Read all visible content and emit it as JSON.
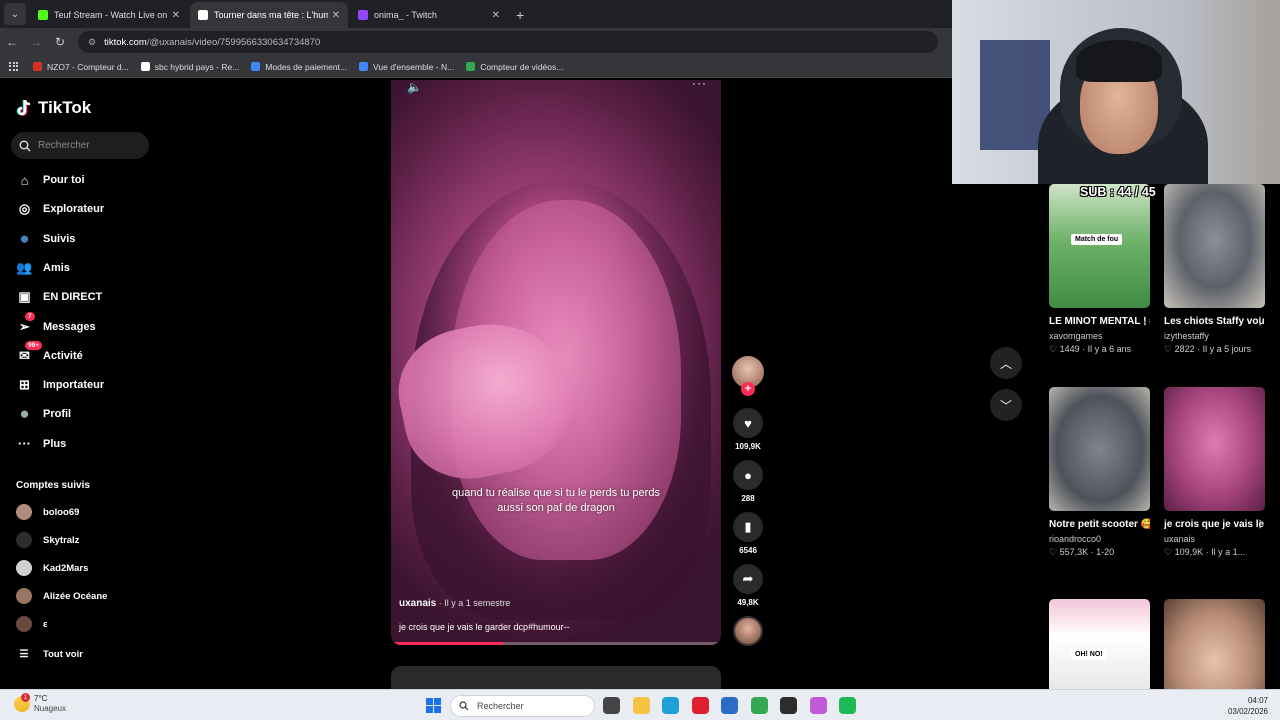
{
  "browser": {
    "tabs": [
      {
        "title": "Teuf Stream - Watch Live on Kick",
        "icon_color": "#53fc18",
        "active": false
      },
      {
        "title": "Tourner dans ma tête : L'humour",
        "icon_color": "#ffffff",
        "active": true
      },
      {
        "title": "onima_ - Twitch",
        "icon_color": "#9146ff",
        "active": false
      }
    ],
    "url_host": "tiktok.com",
    "url_path": "/@uxanais/video/7599566330634734870",
    "bookmarks": [
      {
        "label": "NZO7 - Compteur d...",
        "icon_color": "#d93025"
      },
      {
        "label": "sbc hybrid pays - Re...",
        "icon_color": "#ffffff"
      },
      {
        "label": "Modes de paiement...",
        "icon_color": "#4285f4"
      },
      {
        "label": "Vue d'ensemble - N...",
        "icon_color": "#4285f4"
      },
      {
        "label": "Compteur de vidéos...",
        "icon_color": "#34a853"
      }
    ]
  },
  "tiktok": {
    "logo": "TikTok",
    "search_placeholder": "Rechercher",
    "nav": [
      {
        "label": "Pour toi",
        "icon": "home-icon",
        "glyph": "⌂"
      },
      {
        "label": "Explorateur",
        "icon": "compass-icon",
        "glyph": "◎"
      },
      {
        "label": "Suivis",
        "icon": "following-avatar-icon",
        "glyph": "●"
      },
      {
        "label": "Amis",
        "icon": "friends-icon",
        "glyph": "👥"
      },
      {
        "label": "EN DIRECT",
        "icon": "live-icon",
        "glyph": "▣"
      },
      {
        "label": "Messages",
        "icon": "messages-icon",
        "glyph": "➢",
        "badge": "7"
      },
      {
        "label": "Activité",
        "icon": "activity-icon",
        "glyph": "✉",
        "badge": "99+"
      },
      {
        "label": "Importateur",
        "icon": "upload-icon",
        "glyph": "⊞"
      },
      {
        "label": "Profil",
        "icon": "profile-avatar-icon",
        "glyph": "●"
      },
      {
        "label": "Plus",
        "icon": "more-icon",
        "glyph": "···"
      }
    ],
    "following_title": "Comptes suivis",
    "following": [
      {
        "name": "boloo69",
        "color": "#b08b7a"
      },
      {
        "name": "Skytralz",
        "color": "#2d2d2d"
      },
      {
        "name": "Kad2Mars",
        "color": "#d0d0d0"
      },
      {
        "name": "Alizée Océane",
        "color": "#9a7565"
      },
      {
        "name": "ε",
        "color": "#6b4a44"
      }
    ],
    "see_all": "Tout voir"
  },
  "video": {
    "caption": "quand tu réalise que si tu le perds tu perds aussi son paf de dragon",
    "author": "uxanais",
    "time": " · Il y a 1 semestre",
    "description": "je crois que je vais le garder dcp#humour--",
    "progress": 0.34,
    "likes": "109,9K",
    "comments": "288",
    "saves": "6546",
    "shares": "49,8K"
  },
  "stream_overlay": {
    "sub_counter": "SUB : 44 / 45"
  },
  "suggestions": [
    {
      "title": "LE MINOT MENTAL ! #olympisme...",
      "author": "xavomgames",
      "stats": "♡ 1449 · Il y a 6 ans",
      "thumb": "soccer",
      "thumb_text": "Match de fou"
    },
    {
      "title": "Les chiots Staffy vous bercent...",
      "author": "izythestaffy",
      "stats": "♡ 2822 · Il y a 5 jours",
      "thumb": "puppy",
      "thumb_text": ""
    },
    {
      "title": "Notre petit scooter 🥰🙈🥹",
      "author": "rioandrocco0",
      "stats": "♡ 557,3K · 1-20",
      "thumb": "dog",
      "thumb_text": ""
    },
    {
      "title": "je crois que je vais le garder dcp...",
      "author": "uxanais",
      "stats": "♡ 109,9K · Il y a 1...",
      "thumb": "pink",
      "thumb_text": ""
    },
    {
      "title": "",
      "author": "",
      "stats": "",
      "thumb": "ohno",
      "thumb_text": "OH! NO!"
    },
    {
      "title": "",
      "author": "",
      "stats": "",
      "thumb": "girl",
      "thumb_text": ""
    }
  ],
  "taskbar": {
    "temperature": "7°C",
    "weather": "Nuageux",
    "weather_badge": "1",
    "search_placeholder": "Rechercher",
    "time": "04:07",
    "date": "03/02/2026",
    "apps": [
      {
        "name": "task-view-icon",
        "color": "#444444"
      },
      {
        "name": "file-explorer-icon",
        "color": "#f5c242"
      },
      {
        "name": "edge-icon",
        "color": "#1f9fd8"
      },
      {
        "name": "opera-icon",
        "color": "#e0202e"
      },
      {
        "name": "store-icon",
        "color": "#2b6cc4"
      },
      {
        "name": "chrome-icon",
        "color": "#34a853"
      },
      {
        "name": "obs-icon",
        "color": "#2c2c2c"
      },
      {
        "name": "app-icon",
        "color": "#c05ad8"
      },
      {
        "name": "spotify-icon",
        "color": "#1db954"
      }
    ]
  }
}
